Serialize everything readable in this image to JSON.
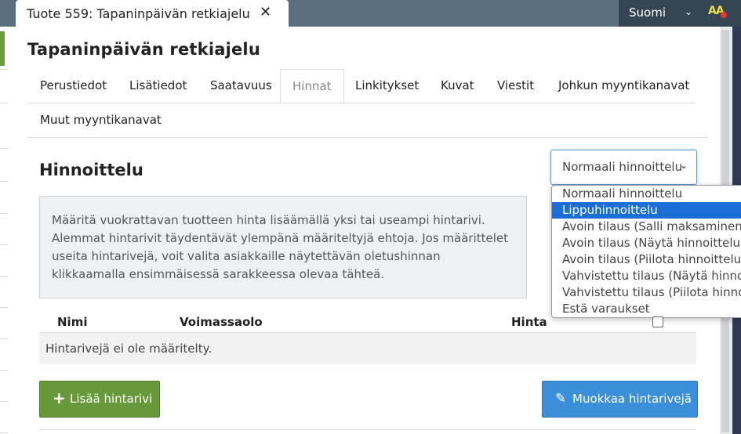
{
  "window": {
    "tab_title": "Tuote 559: Tapaninpäivän retkiajelu",
    "close_glyph": "✕"
  },
  "topbar": {
    "language": "Suomi",
    "font_size_label": "AA"
  },
  "page": {
    "title": "Tapaninpäivän retkiajelu"
  },
  "tabs": [
    {
      "label": "Perustiedot"
    },
    {
      "label": "Lisätiedot"
    },
    {
      "label": "Saatavuus"
    },
    {
      "label": "Hinnat",
      "active": true
    },
    {
      "label": "Linkitykset"
    },
    {
      "label": "Kuvat"
    },
    {
      "label": "Viestit"
    },
    {
      "label": "Johkun myyntikanavat"
    },
    {
      "label": "Muut myyntikanavat"
    }
  ],
  "pricing": {
    "heading": "Hinnoittelu",
    "select_value": "Normaali hinnoittelu",
    "options": [
      "Normaali hinnoittelu",
      "Lippuhinnoittelu",
      "Avoin tilaus (Salli maksaminen)",
      "Avoin tilaus (Näytä hinnoittelu)",
      "Avoin tilaus (Piilota hinnoittelu)",
      "Vahvistettu tilaus (Näytä hinnoittelu)",
      "Vahvistettu tilaus (Piilota hinnoittelu)",
      "Estä varaukset"
    ],
    "highlighted_option": "Lippuhinnoittelu",
    "info_text": "Määritä vuokrattavan tuotteen hinta lisäämällä yksi tai useampi hintarivi. Alemmat hintarivit täydentävät ylempänä määriteltyjä ehtoja. Jos määrittelet useita hintarivejä, voit valita asiakkaille näytettävän oletushinnan klikkaamalla ensimmäisessä sarakkeessa olevaa tähteä."
  },
  "table": {
    "columns": [
      "Nimi",
      "Voimassaolo",
      "Hinta"
    ],
    "empty_text": "Hintarivejä ei ole määritelty."
  },
  "buttons": {
    "add_label": "Lisää hintarivi",
    "edit_label": "Muokkaa hintarivejä"
  },
  "colors": {
    "topbar": "#5b6f7e",
    "add_button": "#67993a",
    "edit_button": "#3a8fd8",
    "option_highlight": "#1c6ed7"
  }
}
